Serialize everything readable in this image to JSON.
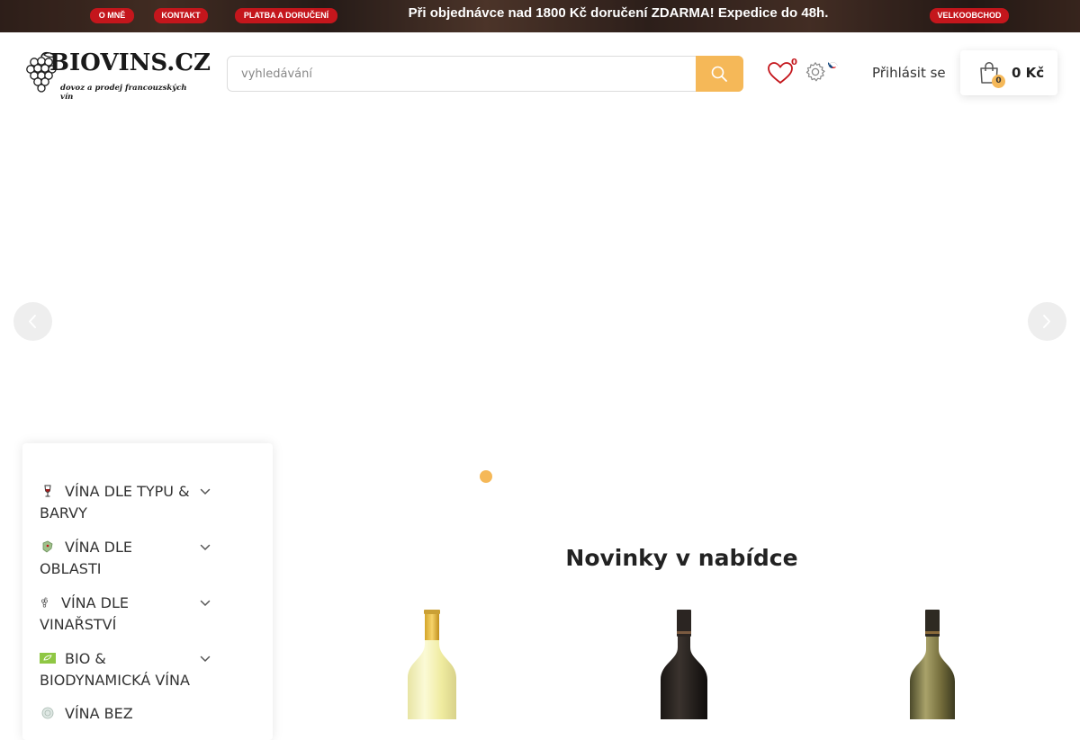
{
  "topbar": {
    "links": [
      "O MNĚ",
      "KONTAKT",
      "PLATBA A DORUČENÍ"
    ],
    "promo": "Při objednávce nad 1800 Kč doručení ZDARMA!  Expedice do 48h.",
    "wholesale": "VELKOOBCHOD",
    "pill_color": "#c4161c"
  },
  "logo": {
    "name": "BIOVINS.CZ",
    "tagline": "dovoz a prodej francouzských vín"
  },
  "search": {
    "placeholder": "vyhledávání",
    "button_icon": "search-icon",
    "accent_color": "#f5b858"
  },
  "header": {
    "wishlist_count": "0",
    "wishlist_icon": "heart-icon",
    "settings_icon": "gear-icon",
    "language_icon": "czech-flag-icon",
    "login_label": "Přihlásit se",
    "cart_count": "0",
    "cart_total": "0 Kč",
    "cart_icon": "shopping-bag-icon"
  },
  "slider": {
    "prev_icon": "chevron-left-icon",
    "next_icon": "chevron-right-icon",
    "pages": 1,
    "active_page": 1
  },
  "sidebar": {
    "items": [
      {
        "label": "VÍNA DLE TYPU & BARVY",
        "icon": "wine-glass-icon"
      },
      {
        "label": "VÍNA DLE OBLASTI",
        "icon": "map-icon"
      },
      {
        "label": "VÍNA DLE VINAŘSTVÍ",
        "icon": "grape-icon"
      },
      {
        "label": "BIO & BIODYNAMICKÁ VÍNA",
        "icon": "eu-organic-icon"
      },
      {
        "label": "VÍNA BEZ",
        "icon": "badge-icon"
      }
    ]
  },
  "products": {
    "title": "Novinky v nabídce",
    "items": [
      {
        "type": "white",
        "icon": "wine-bottle-icon"
      },
      {
        "type": "red",
        "icon": "wine-bottle-icon"
      },
      {
        "type": "white",
        "icon": "wine-bottle-icon"
      }
    ]
  }
}
